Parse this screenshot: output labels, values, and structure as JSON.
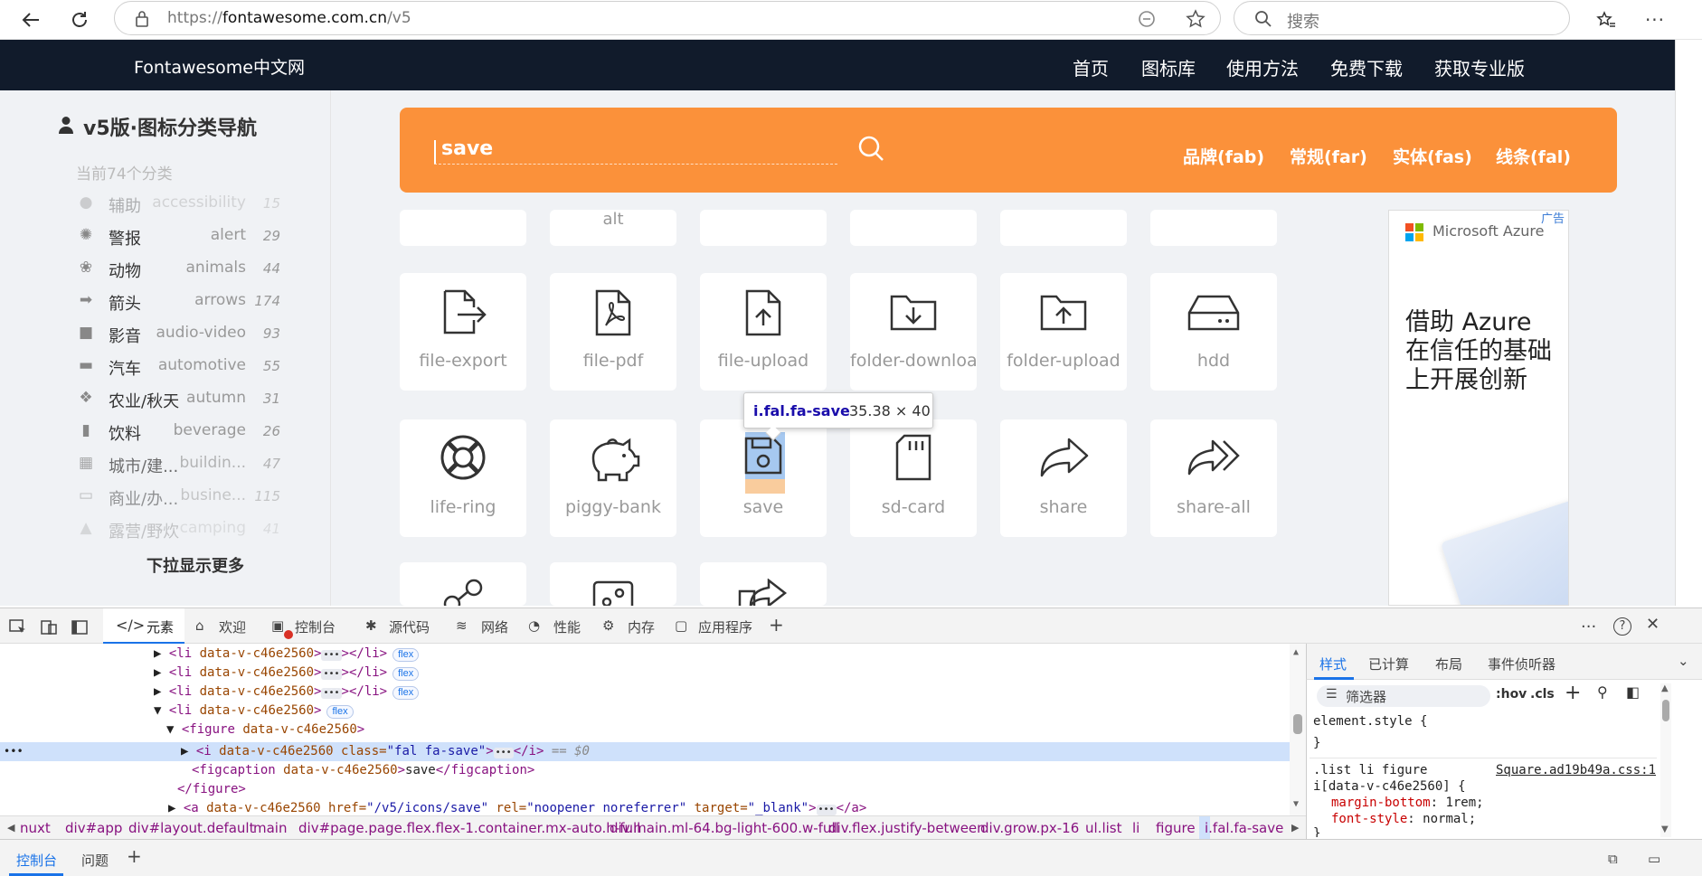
{
  "browser": {
    "url_prefix": "https://",
    "url_host": "fontawesome.com.cn",
    "url_path": "/v5",
    "search_placeholder": "搜索"
  },
  "site": {
    "brand": "Fontawesome中文网",
    "nav": [
      "首页",
      "图标库",
      "使用方法",
      "免费下载",
      "获取专业版"
    ]
  },
  "sidebar": {
    "title": "v5版·图标分类导航",
    "count": "当前74个分类",
    "categories": [
      {
        "zh": "辅助",
        "en": "accessibility",
        "n": "15",
        "icon": "universal-access-icon"
      },
      {
        "zh": "警报",
        "en": "alert",
        "n": "29",
        "icon": "bell-icon"
      },
      {
        "zh": "动物",
        "en": "animals",
        "n": "44",
        "icon": "paw-icon"
      },
      {
        "zh": "箭头",
        "en": "arrows",
        "n": "174",
        "icon": "arrow-square-icon"
      },
      {
        "zh": "影音",
        "en": "audio-video",
        "n": "93",
        "icon": "video-icon"
      },
      {
        "zh": "汽车",
        "en": "automotive",
        "n": "55",
        "icon": "car-icon"
      },
      {
        "zh": "农业/秋天",
        "en": "autumn",
        "n": "31",
        "icon": "leaf-icon"
      },
      {
        "zh": "饮料",
        "en": "beverage",
        "n": "26",
        "icon": "mug-icon"
      },
      {
        "zh": "城市/建...",
        "en": "buildin...",
        "n": "47",
        "icon": "building-icon"
      },
      {
        "zh": "商业/办...",
        "en": "busine...",
        "n": "115",
        "icon": "briefcase-icon"
      },
      {
        "zh": "露营/野炊",
        "en": "camping",
        "n": "41",
        "icon": "campground-icon"
      }
    ],
    "more": "下拉显示更多"
  },
  "search": {
    "query": "save",
    "types": [
      "品牌(fab)",
      "常规(far)",
      "实体(fas)",
      "线条(fal)"
    ]
  },
  "grid": {
    "top_partial": [
      "",
      "alt",
      "",
      "",
      "",
      ""
    ],
    "row1": [
      "file-export",
      "file-pdf",
      "file-upload",
      "folder-download",
      "folder-upload",
      "hdd"
    ],
    "row2": [
      "life-ring",
      "piggy-bank",
      "save",
      "sd-card",
      "share",
      "share-all"
    ]
  },
  "tooltip": {
    "selector": "i.fal.fa-save",
    "dims": "35.38 × 40"
  },
  "ad": {
    "tag": "广告",
    "brand": "Microsoft Azure",
    "headline_1": "借助 Azure",
    "headline_2": "在信任的基础",
    "headline_3": "上开展创新"
  },
  "devtools": {
    "tabs": [
      "元素",
      "欢迎",
      "控制台",
      "源代码",
      "网络",
      "性能",
      "内存",
      "应用程序"
    ],
    "style_tabs": [
      "样式",
      "已计算",
      "布局",
      "事件侦听器"
    ],
    "filter": "筛选器",
    "hov": ":hov",
    "cls": ".cls",
    "lines": {
      "li_tag": "<li",
      "li_attr": " data-v-c46e2560",
      "li_close": "></li>",
      "li_open_end": ">",
      "flex": "flex",
      "figure_open": "<figure",
      "figure_attr": " data-v-c46e2560",
      "figure_end": ">",
      "i_tag": "<i",
      "i_attr1": " data-v-c46e2560",
      "i_attr2": " class=",
      "i_class": "\"fal fa-save\"",
      "i_end": ">",
      "i_close": "</i>",
      "eq0": " == $0",
      "figcaption_open": "<figcaption",
      "figcaption_attr": " data-v-c46e2560",
      "figcaption_text": "save",
      "figcaption_close": "</figcaption>",
      "figure_close": "</figure>",
      "a_tag": "<a",
      "a_attr": " data-v-c46e2560 href=",
      "a_href": "\"/v5/icons/save\"",
      "a_rel_attr": " rel=",
      "a_rel": "\"noopener noreferrer\"",
      "a_target_attr": " target=",
      "a_target": "\"_blank\"",
      "a_close": "</a>"
    },
    "breadcrumbs": [
      "nuxt",
      "div#app",
      "div#layout.default",
      "main",
      "div#page.page.flex.flex-1.container.mx-auto.h-full",
      "div.main.ml-64.bg-light-600.w-full",
      "div.flex.justify-between",
      "div.grow.px-16",
      "ul.list",
      "li",
      "figure",
      "i.fal.fa-save"
    ],
    "css": {
      "element_style": "element.style {",
      "close_brace": "}",
      "rule_sel1": ".list li figure",
      "rule_sel2": "i[data-v-c46e2560] {",
      "rule_src": "Square.ad19b49a.css:1",
      "prop1": "margin-bottom",
      "val1": "1rem;",
      "prop2": "font-style",
      "val2": "normal;"
    },
    "drawer_tabs": [
      "控制台",
      "问题"
    ]
  }
}
